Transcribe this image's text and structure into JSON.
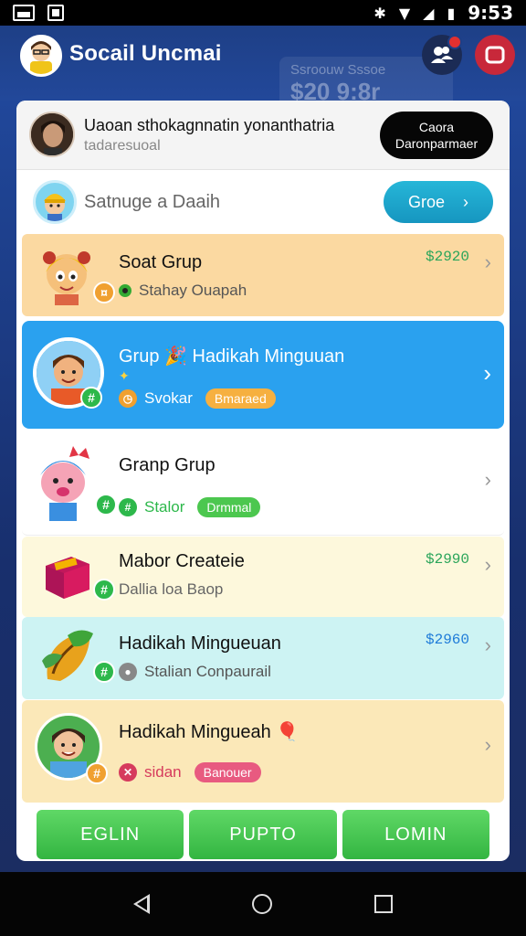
{
  "status_bar": {
    "time": "9:53"
  },
  "app_bar": {
    "title": "Socail Uncmai",
    "background_label": "Ssroouw Sssoe",
    "background_amount": "$20 9:8r",
    "people_icon": "people-icon",
    "stop_icon": "stop-icon"
  },
  "profile": {
    "name": "Uaoan sthokagnnatin yonanthatria",
    "subtitle": "tadaresuoal",
    "button_line1": "Caora",
    "button_line2": "Daronparmaer"
  },
  "search": {
    "placeholder": "Satnuge a Daaih",
    "go_label": "Groe"
  },
  "rows": [
    {
      "title": "Soat Grup",
      "sub": "Stahay Ouapah",
      "price": "$2920",
      "badge_icon": "coin-icon",
      "dot_icon": "dot-icon"
    },
    {
      "title": "Grup 🎉 Hadikah Minguuan",
      "sub": "Svokar",
      "pill": "Bmaraed",
      "badge_icon": "hash-icon",
      "dot_icon": "clock-icon"
    },
    {
      "title": "Granp Grup",
      "sub": "Stalor",
      "pill": "Drmmal",
      "badge_icon": "hash-icon",
      "dot_icon": "hash-icon"
    },
    {
      "title": "Mabor Createie",
      "sub": "Dallia loa Baop",
      "price": "$2990",
      "badge_icon": "hash-icon"
    },
    {
      "title": "Hadikah Mingueuan",
      "sub": "Stalian Conpaurail",
      "price": "$2960",
      "badge_icon": "hash-icon",
      "dot_icon": "dot-icon"
    },
    {
      "title": "Hadikah Mingueah 🎈",
      "sub": "sidan",
      "pill": "Banouer",
      "badge_icon": "hash-icon",
      "dot_icon": "close-icon"
    }
  ],
  "footer": {
    "btn1": "EGLIN",
    "btn2": "PUPTO",
    "btn3": "LOMIN"
  },
  "colors": {
    "accent_blue": "#2aa1ef",
    "green": "#33b541",
    "price_green": "#2aa55a"
  }
}
